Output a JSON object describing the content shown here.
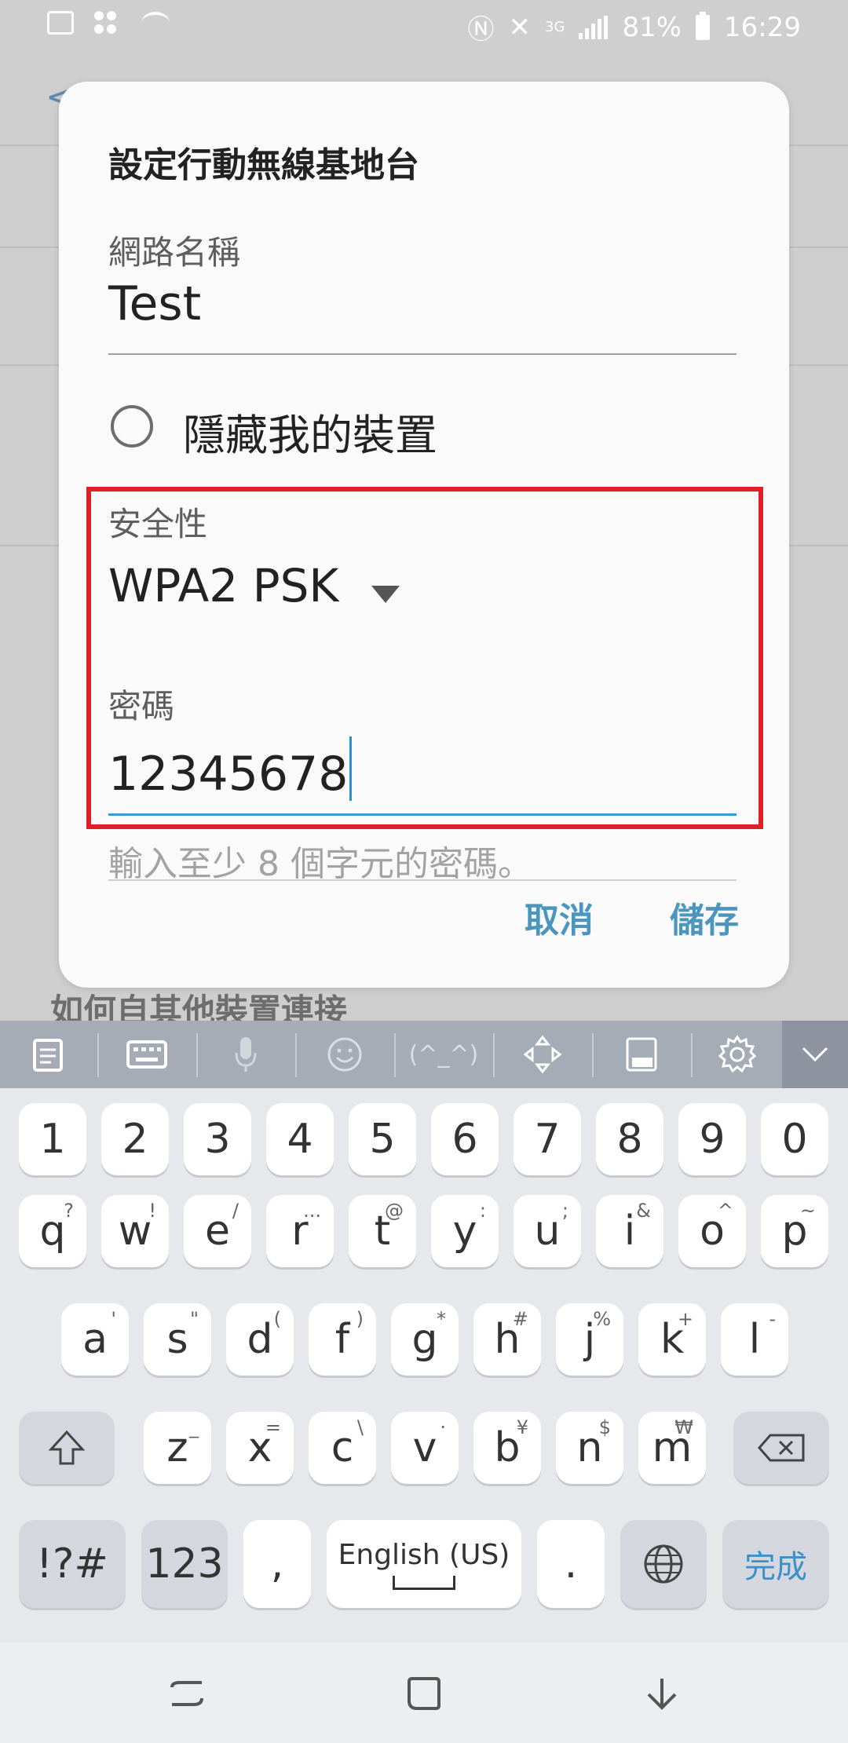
{
  "status_bar": {
    "network": "3G",
    "battery": "81%",
    "time": "16:29"
  },
  "background": {
    "heading": "如何自其他裝置連接"
  },
  "dialog": {
    "title": "設定行動無線基地台",
    "network_name": {
      "label": "網路名稱",
      "value": "Test"
    },
    "hide_device": {
      "label": "隱藏我的裝置",
      "checked": false
    },
    "security": {
      "label": "安全性",
      "value": "WPA2 PSK"
    },
    "password": {
      "label": "密碼",
      "value": "12345678",
      "hint": "輸入至少 8 個字元的密碼。"
    },
    "cancel_label": "取消",
    "save_label": "儲存"
  },
  "keyboard": {
    "emoticon_label": "(^_^)",
    "number_row": [
      "1",
      "2",
      "3",
      "4",
      "5",
      "6",
      "7",
      "8",
      "9",
      "0"
    ],
    "row1": [
      {
        "key": "q",
        "sup": "?"
      },
      {
        "key": "w",
        "sup": "!"
      },
      {
        "key": "e",
        "sup": "/"
      },
      {
        "key": "r",
        "sup": "..."
      },
      {
        "key": "t",
        "sup": "@"
      },
      {
        "key": "y",
        "sup": ":"
      },
      {
        "key": "u",
        "sup": ";"
      },
      {
        "key": "i",
        "sup": "&"
      },
      {
        "key": "o",
        "sup": "^"
      },
      {
        "key": "p",
        "sup": "~"
      }
    ],
    "row2": [
      {
        "key": "a",
        "sup": "'"
      },
      {
        "key": "s",
        "sup": "\""
      },
      {
        "key": "d",
        "sup": "("
      },
      {
        "key": "f",
        "sup": ")"
      },
      {
        "key": "g",
        "sup": "*"
      },
      {
        "key": "h",
        "sup": "#"
      },
      {
        "key": "j",
        "sup": "%"
      },
      {
        "key": "k",
        "sup": "+"
      },
      {
        "key": "l",
        "sup": "-"
      }
    ],
    "row3": [
      {
        "key": "z",
        "sup": "_"
      },
      {
        "key": "x",
        "sup": "="
      },
      {
        "key": "c",
        "sup": "\\"
      },
      {
        "key": "v",
        "sup": "·"
      },
      {
        "key": "b",
        "sup": "¥"
      },
      {
        "key": "n",
        "sup": "$"
      },
      {
        "key": "m",
        "sup": "₩"
      }
    ],
    "symbols_label": "!?#",
    "numbers_label": "123",
    "comma_label": ",",
    "space_label": "English (US)",
    "period_label": ".",
    "done_label": "完成"
  },
  "colors": {
    "accent": "#4a96bf",
    "highlight_border": "#e01f26",
    "cursor": "#2a8fd3"
  }
}
